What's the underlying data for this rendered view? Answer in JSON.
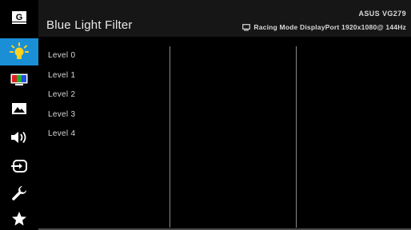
{
  "header": {
    "title": "Blue Light Filter",
    "model": "ASUS VG279",
    "status_text": "Racing Mode DisplayPort 1920x1080@ 144Hz",
    "status_icon": "monitor-icon"
  },
  "sidebar": {
    "items": [
      {
        "icon": "gaming-g-icon",
        "active": false
      },
      {
        "icon": "blue-light-filter-icon",
        "active": true
      },
      {
        "icon": "color-icon",
        "active": false
      },
      {
        "icon": "image-icon",
        "active": false
      },
      {
        "icon": "sound-icon",
        "active": false
      },
      {
        "icon": "input-select-icon",
        "active": false
      },
      {
        "icon": "system-setup-icon",
        "active": false
      },
      {
        "icon": "my-favorite-icon",
        "active": false
      }
    ]
  },
  "options": {
    "items": [
      "Level 0",
      "Level 1",
      "Level 2",
      "Level 3",
      "Level 4"
    ]
  },
  "colors": {
    "background": "#000000",
    "header": "#161616",
    "accent": "#1a8fd6",
    "text": "#d8d8d8"
  }
}
